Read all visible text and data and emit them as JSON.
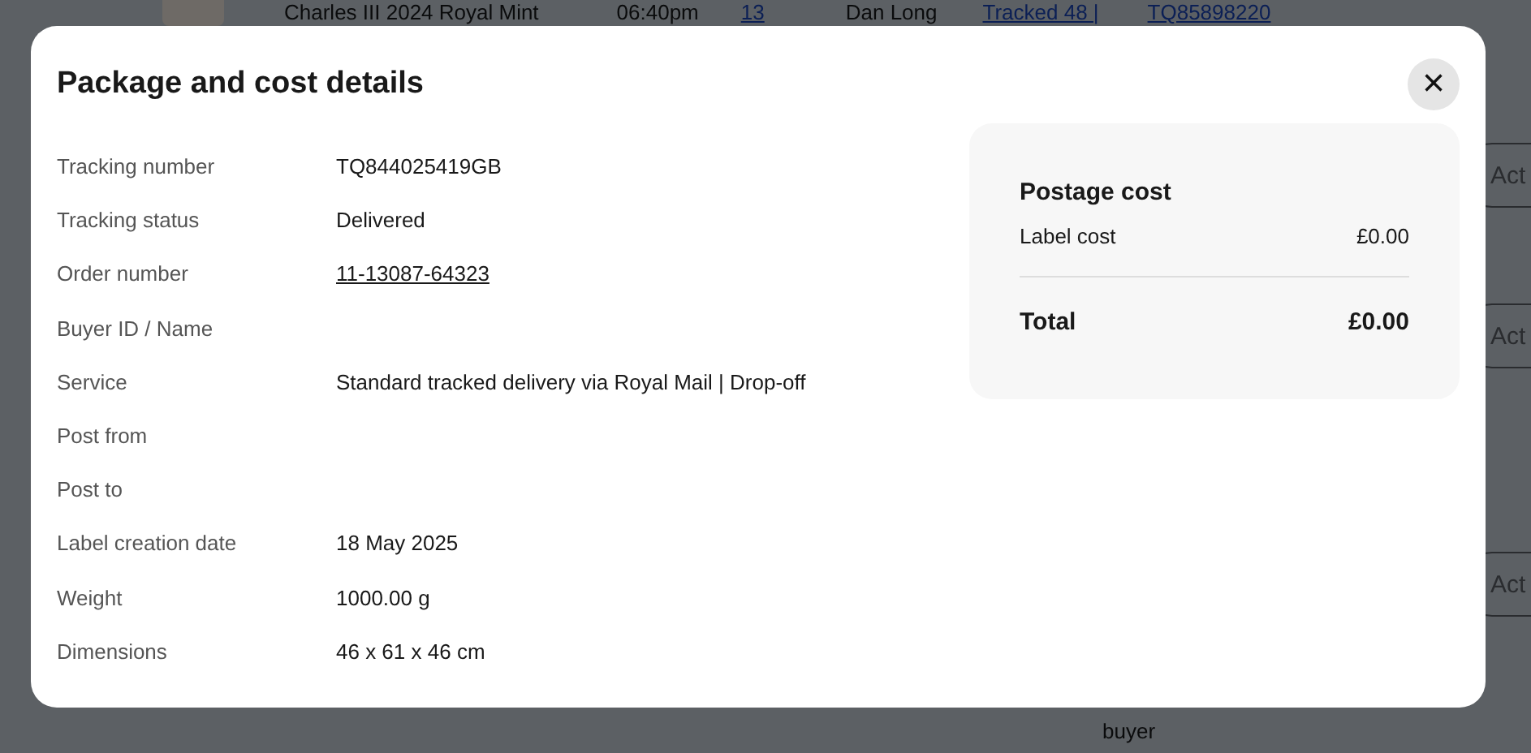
{
  "background": {
    "row_texts": [
      {
        "text": "Charles III 2024 Royal Mint",
        "link": false
      },
      {
        "text": "06:40pm",
        "link": false
      },
      {
        "text": "13",
        "link": true
      },
      {
        "text": "Dan Long",
        "link": false
      },
      {
        "text": "Tracked 48 |",
        "link": true
      },
      {
        "text": "TQ85898220",
        "link": true
      }
    ],
    "action_buttons": [
      "Act",
      "Act",
      "Act"
    ],
    "footer_text": "buyer"
  },
  "dialog": {
    "title": "Package and cost details",
    "details": [
      {
        "label": "Tracking number",
        "value": "TQ844025419GB",
        "link": false
      },
      {
        "label": "Tracking status",
        "value": "Delivered",
        "link": false
      },
      {
        "label": "Order number",
        "value": "11-13087-64323",
        "link": true
      },
      {
        "label": "Buyer ID / Name"
      },
      {
        "label": "Service",
        "value": "Standard tracked delivery via Royal Mail | Drop-off",
        "link": false
      },
      {
        "label": "Post from"
      },
      {
        "label": "Post to"
      },
      {
        "label": "Label creation date",
        "value": "18 May 2025",
        "link": false
      },
      {
        "label": "Weight",
        "value": "1000.00 g",
        "link": false
      },
      {
        "label": "Dimensions",
        "value": "46 x 61 x 46 cm",
        "link": false
      }
    ],
    "cost": {
      "title": "Postage cost",
      "lines": [
        {
          "label": "Label cost",
          "value": "£0.00"
        }
      ],
      "total": {
        "label": "Total",
        "value": "£0.00"
      }
    },
    "close_label": "×"
  }
}
